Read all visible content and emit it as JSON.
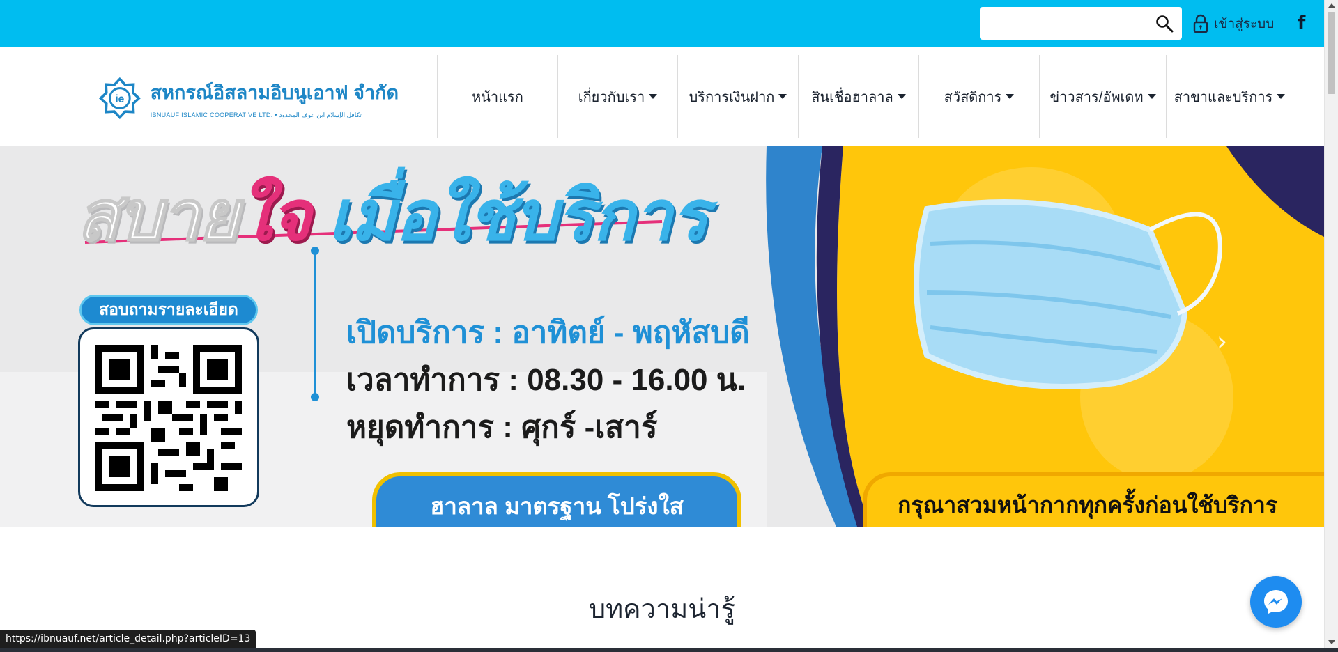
{
  "topbar": {
    "search_placeholder": "",
    "search_value": "",
    "login_label": "เข้าสู่ระบบ",
    "facebook_glyph": "f",
    "background_color": "#00bdf0"
  },
  "header": {
    "logo_title": "สหกรณ์อิสลามอิบนูเอาฟ จำกัด",
    "logo_subtitle": "IBNUAUF ISLAMIC COOPERATIVE LTD.  •  تكافل الإسلام ابن عوف المحدود",
    "nav": [
      {
        "label": "หน้าแรก",
        "dropdown": false
      },
      {
        "label": "เกี่ยวกับเรา",
        "dropdown": true
      },
      {
        "label": "บริการเงินฝาก",
        "dropdown": true
      },
      {
        "label": "สินเชื่อฮาลาล",
        "dropdown": true
      },
      {
        "label": "สวัสดิการ",
        "dropdown": true
      },
      {
        "label": "ข่าวสาร/อัพเดท",
        "dropdown": true
      },
      {
        "label": "สาขาและบริการ",
        "dropdown": true
      }
    ]
  },
  "banner": {
    "headline_part1": "สบาย",
    "headline_part2": "ใจ",
    "headline_part3": " เมื่อใช้บริการ",
    "inquire_label": "สอบถามรายละเอียด",
    "open_days": "เปิดบริการ : อาทิตย์ - พฤหัสบดี",
    "office_hours": "เวลาทำการ : 08.30 - 16.00 น.",
    "closed_days": "หยุดทำการ : ศุกร์ -เสาร์",
    "halal_badge": "ฮาลาล มาตรฐาน โปร่งใส",
    "mask_notice": "กรุณาสวมหน้ากากทุกครั้งก่อนใช้บริการ",
    "next_arrow": "›",
    "colors": {
      "blue": "#1f90d6",
      "yellow": "#ffc60b",
      "navy": "#2a2560",
      "pink": "#e5307a"
    }
  },
  "articles": {
    "section_title": "บทความน่ารู้"
  },
  "status_bar": {
    "url": "https://ibnuauf.net/article_detail.php?articleID=13"
  },
  "icons": [
    "search-icon",
    "lock-icon",
    "facebook-icon",
    "messenger-icon",
    "chevron-right-icon",
    "caret-down-icon",
    "qr-code"
  ]
}
